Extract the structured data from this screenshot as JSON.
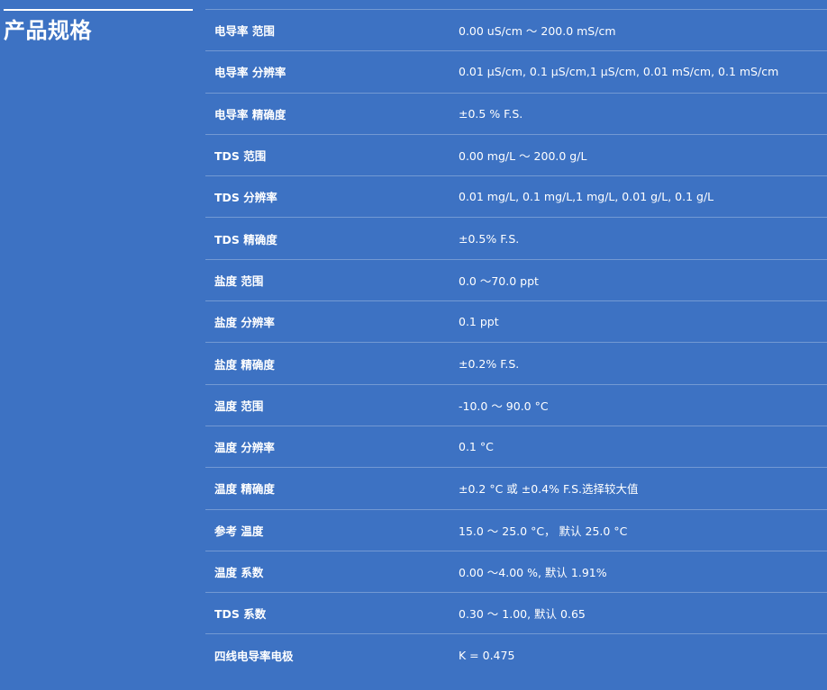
{
  "section": {
    "title": "产品规格"
  },
  "specs": [
    {
      "label": "电导率 范围",
      "value": "0.00 uS/cm ～ 200.0 mS/cm"
    },
    {
      "label": "电导率 分辨率",
      "value": "0.01 μS/cm, 0.1 μS/cm,1 μS/cm, 0.01 mS/cm, 0.1 mS/cm"
    },
    {
      "label": "电导率 精确度",
      "value": "±0.5 % F.S."
    },
    {
      "label": "TDS 范围",
      "value": "0.00 mg/L ～ 200.0 g/L"
    },
    {
      "label": "TDS 分辨率",
      "value": "0.01 mg/L, 0.1 mg/L,1 mg/L, 0.01 g/L, 0.1 g/L"
    },
    {
      "label": "TDS 精确度",
      "value": "±0.5% F.S."
    },
    {
      "label": "盐度 范围",
      "value": "0.0 ～70.0 ppt"
    },
    {
      "label": "盐度 分辨率",
      "value": "0.1 ppt"
    },
    {
      "label": "盐度 精确度",
      "value": "±0.2% F.S."
    },
    {
      "label": "温度 范围",
      "value": "-10.0 ～ 90.0 °C"
    },
    {
      "label": "温度 分辨率",
      "value": "0.1 °C"
    },
    {
      "label": "温度 精确度",
      "value": "±0.2 °C 或 ±0.4% F.S.选择较大值"
    },
    {
      "label": "参考 温度",
      "value": "15.0 ～ 25.0 °C， 默认 25.0 °C"
    },
    {
      "label": "温度 系数",
      "value": "0.00 ～4.00 %, 默认 1.91%"
    },
    {
      "label": "TDS 系数",
      "value": "0.30 ～ 1.00, 默认 0.65"
    },
    {
      "label": "四线电导率电极",
      "value": "K = 0.475"
    }
  ]
}
